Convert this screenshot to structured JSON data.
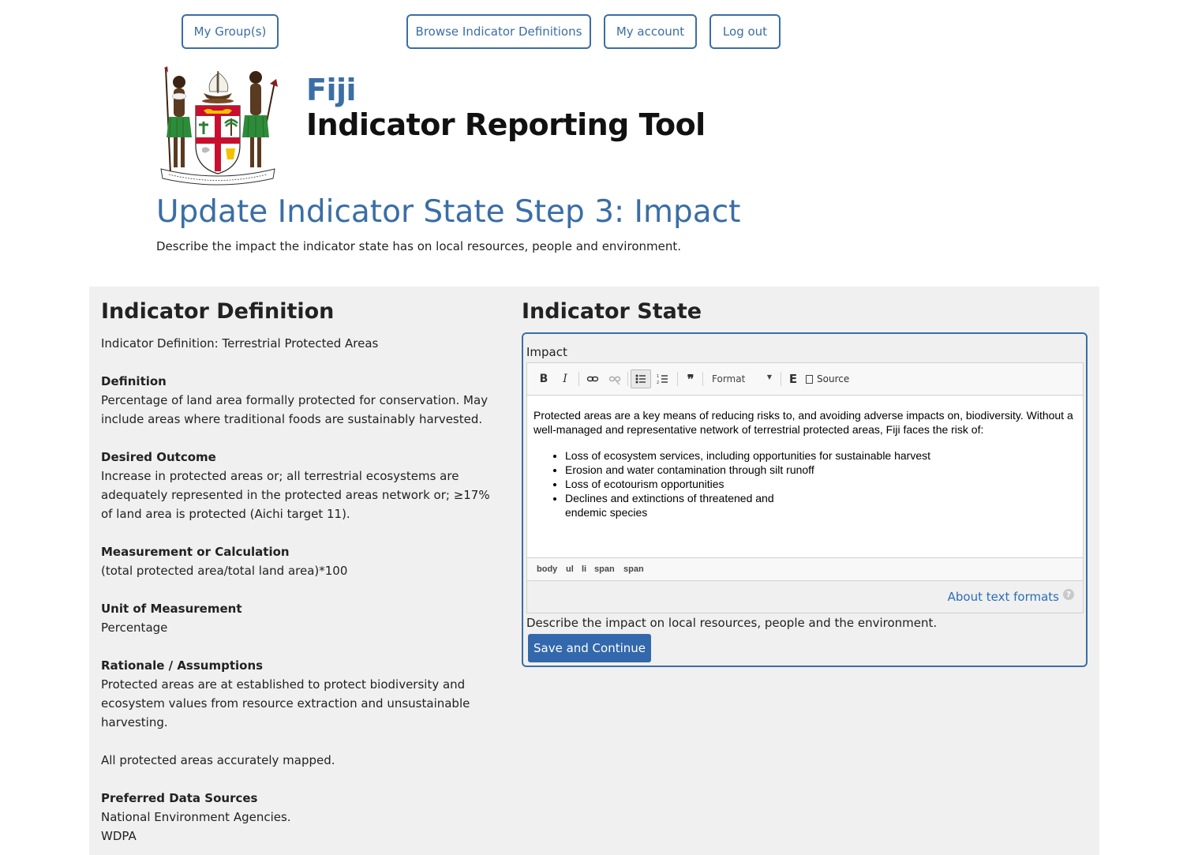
{
  "nav": {
    "my_groups": "My Group(s)",
    "browse_definitions": "Browse Indicator Definitions",
    "my_account": "My account",
    "log_out": "Log out",
    "accent_color": "#3a6ea5"
  },
  "header": {
    "logo": "fiji-coat-of-arms",
    "logo_motto": "Rerevaka na Kalou ka doka na Tui",
    "site_name": "Fiji",
    "site_slogan": "Indicator Reporting Tool"
  },
  "page": {
    "title": "Update Indicator State Step 3: Impact",
    "description": "Describe the impact the indicator state has on local resources, people and environment."
  },
  "definition": {
    "heading": "Indicator Definition",
    "intro": "Indicator Definition: Terrestrial Protected Areas",
    "definition_label": "Definition",
    "definition_text": "Percentage of land area formally protected for conservation. May include areas where traditional foods are sustainably harvested.",
    "outcome_label": "Desired Outcome",
    "outcome_text": "Increase in protected areas or; all terrestrial ecosystems are adequately represented in the protected areas network or; ≥17% of land area is protected (Aichi target 11).",
    "measurement_label": "Measurement or Calculation",
    "measurement_text": "(total protected area/total land area)*100",
    "unit_label": "Unit of Measurement",
    "unit_text": "Percentage",
    "rationale_label": "Rationale / Assumptions",
    "rationale_text": "Protected areas are at established to protect biodiversity and ecosystem values from resource extraction and unsustainable harvesting.",
    "rationale_note": "All protected areas accurately mapped.",
    "sources_label": "Preferred Data Sources",
    "source_1": "National Environment Agencies.",
    "source_2": "WDPA"
  },
  "state": {
    "heading": "Indicator State",
    "field_label": "Impact",
    "toolbar": {
      "bold": "B",
      "italic": "I",
      "link_icon": "link-icon",
      "unlink_icon": "unlink-icon",
      "bulleted_list_icon": "bulleted-list-icon",
      "numbered_list_icon": "numbered-list-icon",
      "blockquote": "99",
      "format": "Format",
      "embed": "E",
      "source": "Source"
    },
    "content": {
      "paragraph": "Protected areas are a key means of reducing risks to, and avoiding adverse impacts on, biodiversity. Without a well-managed and representative network of terrestrial protected areas, Fiji faces the risk of:",
      "items": [
        "Loss of ecosystem services, including opportunities for sustainable harvest",
        "Erosion and water contamination through silt runoff",
        "Loss of ecotourism opportunities",
        "Declines and extinctions of threatened and endemic species"
      ]
    },
    "path": [
      "body",
      "ul",
      "li",
      "span",
      "span"
    ],
    "about_formats": "About text formats",
    "help": "?",
    "field_description": "Describe the impact on local resources, people and the environment.",
    "save_button": "Save and Continue",
    "button_color": "#3368ac"
  }
}
